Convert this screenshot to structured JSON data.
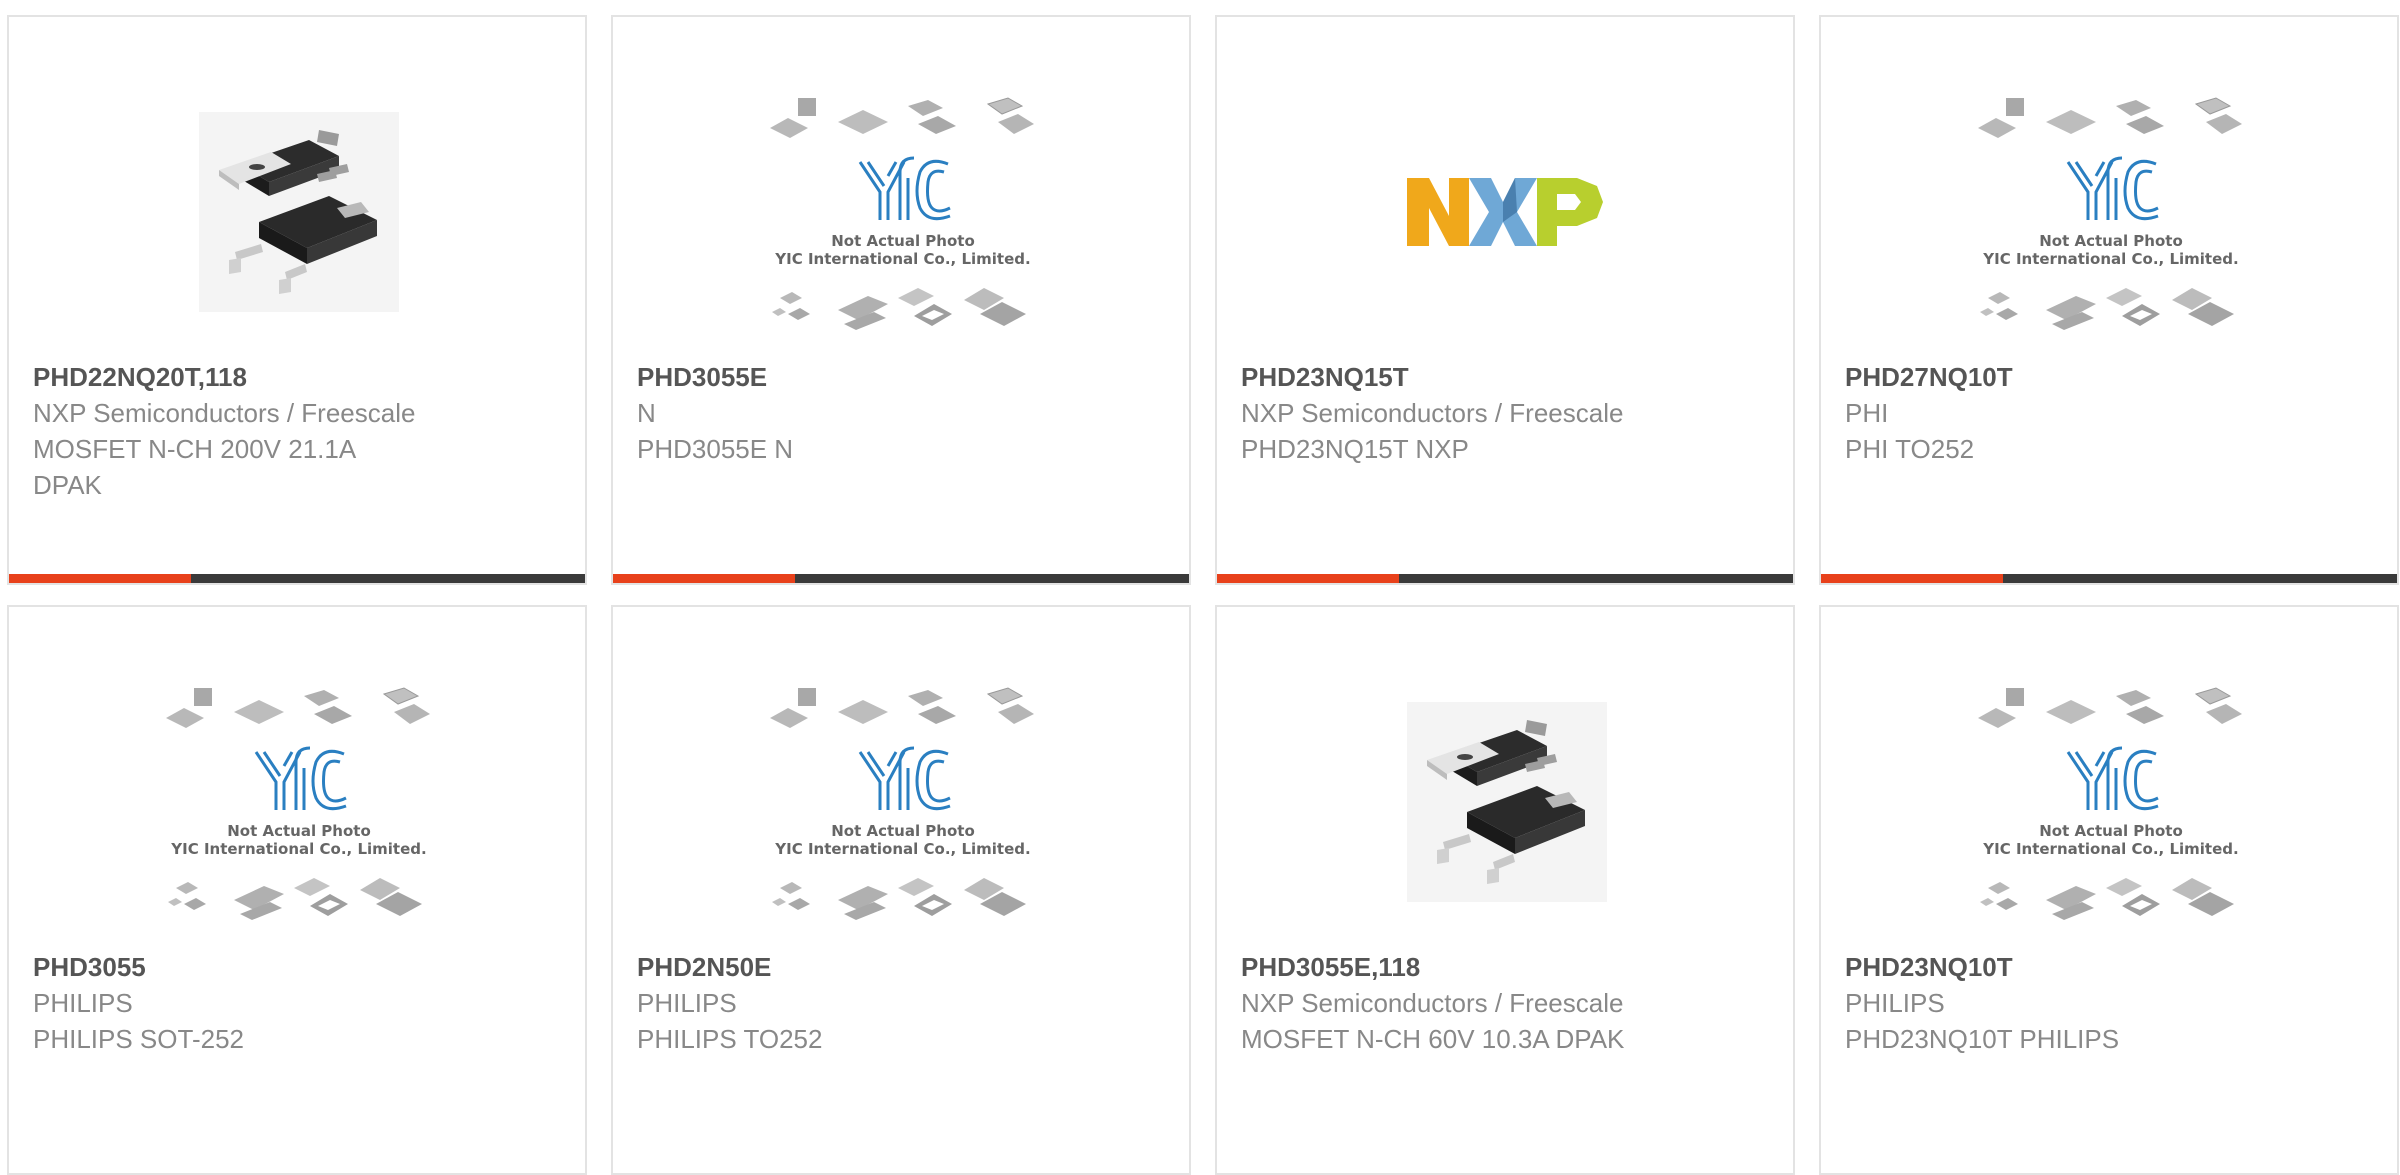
{
  "products": [
    {
      "part_number": "PHD22NQ20T,118",
      "manufacturer": "NXP Semiconductors / Freescale",
      "description": "MOSFET N-CH 200V 21.1A",
      "description_2": "DPAK",
      "image": "dpak-photo",
      "show_bar": true
    },
    {
      "part_number": "PHD3055E",
      "manufacturer": "N",
      "description": "PHD3055E N",
      "description_2": "",
      "image": "yic-placeholder",
      "show_bar": true
    },
    {
      "part_number": "PHD23NQ15T",
      "manufacturer": "NXP Semiconductors / Freescale",
      "description": "PHD23NQ15T NXP",
      "description_2": "",
      "image": "nxp-logo",
      "show_bar": true
    },
    {
      "part_number": "PHD27NQ10T",
      "manufacturer": "PHI",
      "description": "PHI TO252",
      "description_2": "",
      "image": "yic-placeholder",
      "show_bar": true
    },
    {
      "part_number": "PHD3055",
      "manufacturer": "PHILIPS",
      "description": "PHILIPS SOT-252",
      "description_2": "",
      "image": "yic-placeholder",
      "show_bar": false
    },
    {
      "part_number": "PHD2N50E",
      "manufacturer": "PHILIPS",
      "description": "PHILIPS TO252",
      "description_2": "",
      "image": "yic-placeholder",
      "show_bar": false
    },
    {
      "part_number": "PHD3055E,118",
      "manufacturer": "NXP Semiconductors / Freescale",
      "description": "MOSFET N-CH 60V 10.3A DPAK",
      "description_2": "",
      "image": "dpak-photo",
      "show_bar": false
    },
    {
      "part_number": "PHD23NQ10T",
      "manufacturer": "PHILIPS",
      "description": "PHD23NQ10T PHILIPS",
      "description_2": "",
      "image": "yic-placeholder",
      "show_bar": false
    }
  ],
  "placeholder": {
    "line1": "Not Actual Photo",
    "line2": "YIC International Co., Limited."
  },
  "colors": {
    "accent": "#e8411b",
    "bar": "#3a3a3a",
    "border": "#e3e3e3",
    "title": "#555555",
    "text": "#888888"
  }
}
